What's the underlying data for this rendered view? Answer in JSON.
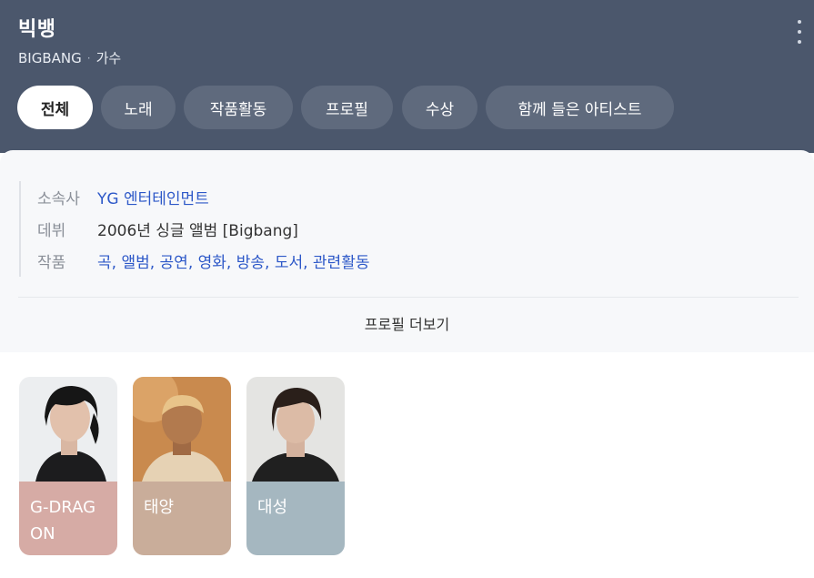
{
  "header": {
    "title": "빅뱅",
    "name_en": "BIGBANG",
    "separator": "·",
    "role": "가수",
    "tabs": [
      {
        "label": "전체",
        "active": true
      },
      {
        "label": "노래",
        "active": false
      },
      {
        "label": "작품활동",
        "active": false
      },
      {
        "label": "프로필",
        "active": false
      },
      {
        "label": "수상",
        "active": false
      },
      {
        "label": "함께 들은 아티스트",
        "active": false
      }
    ],
    "menu_icon": "more-vertical-icon"
  },
  "profile": {
    "agency_label": "소속사",
    "agency_value": "YG 엔터테인먼트",
    "debut_label": "데뷔",
    "debut_value": "2006년 싱글 앨범 [Bigbang]",
    "works_label": "작품",
    "works_items": [
      "곡",
      "앨범",
      "공연",
      "영화",
      "방송",
      "도서",
      "관련활동"
    ],
    "works_separator": ", ",
    "more_label": "프로필 더보기"
  },
  "members": [
    {
      "name": "G-DRAGON",
      "color": "#d6aba5"
    },
    {
      "name": "태양",
      "color": "#c9ad9a"
    },
    {
      "name": "대성",
      "color": "#a5b7c0"
    }
  ],
  "colors": {
    "header_bg": "#4b576c",
    "tab_bg": "#5f6a7d",
    "link": "#2d58c8",
    "profile_bg": "#f7f8fa"
  }
}
